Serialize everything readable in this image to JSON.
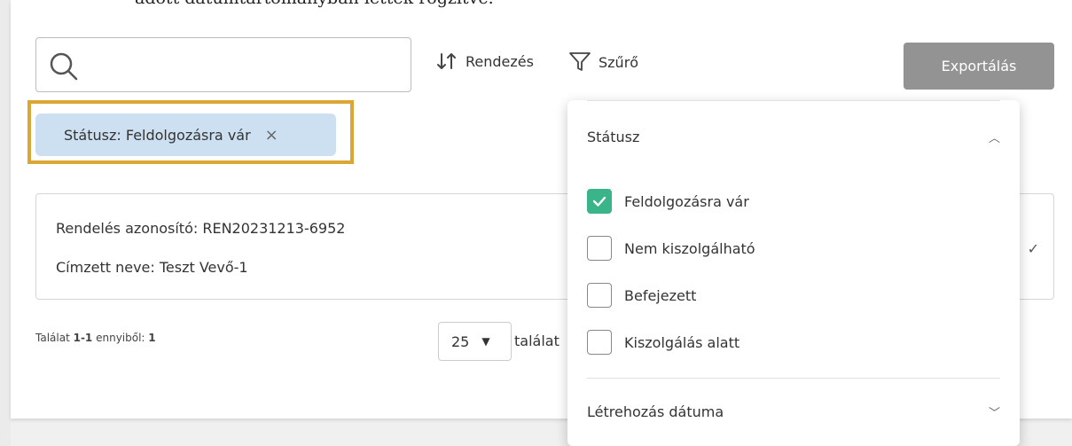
{
  "intro_text": "adott dátumtartományban lettek rögzítve.",
  "search": {
    "placeholder": "",
    "value": ""
  },
  "toolbar": {
    "sort_label": "Rendezés",
    "filter_label": "Szűrő",
    "export_label": "Exportálás"
  },
  "active_filter": {
    "label": "Státusz: Feldolgozásra vár",
    "close_symbol": "×"
  },
  "order": {
    "id_line": "Rendelés azonosító: REN20231213-6952",
    "recipient_line": "Címzett neve: Teszt Vevő-1"
  },
  "pagination": {
    "prefix": "Találat ",
    "range": "1-1",
    "middle": " ennyiből: ",
    "total": "1",
    "page_size": "25",
    "page_size_suffix": "találat"
  },
  "filter_panel": {
    "status_section": "Státusz",
    "options": [
      {
        "label": "Feldolgozásra vár",
        "checked": true
      },
      {
        "label": "Nem kiszolgálható",
        "checked": false
      },
      {
        "label": "Befejezett",
        "checked": false
      },
      {
        "label": "Kiszolgálás alatt",
        "checked": false
      }
    ],
    "date_section": "Létrehozás dátuma"
  },
  "colors": {
    "chip_bg": "#cde0f1",
    "highlight_frame": "#dba633",
    "checked": "#3ab58a",
    "export_bg": "#939393"
  }
}
